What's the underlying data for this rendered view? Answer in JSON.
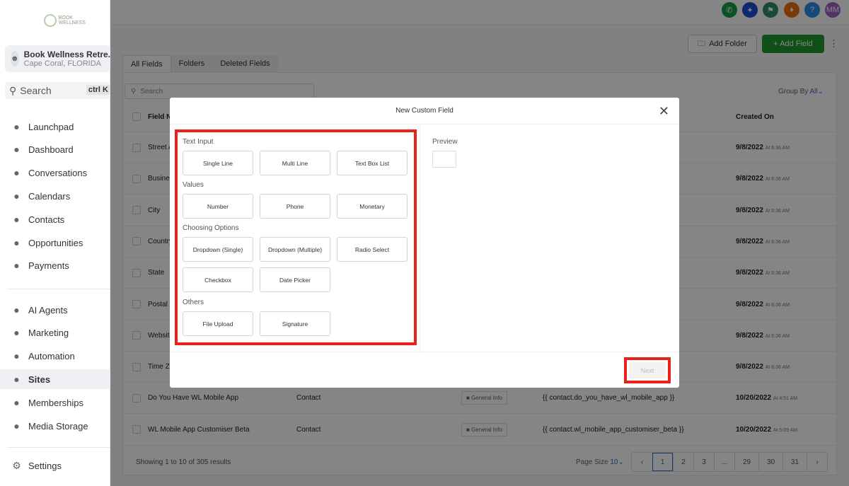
{
  "sidebar": {
    "logo_text": "BOOK WELLNESS",
    "location": {
      "name": "Book Wellness Retre...",
      "sub": "Cape Coral, FLORIDA"
    },
    "search": "Search",
    "search_shortcut": "ctrl K",
    "items": [
      {
        "label": "Launchpad",
        "icon": "rocket-icon"
      },
      {
        "label": "Dashboard",
        "icon": "grid-icon"
      },
      {
        "label": "Conversations",
        "icon": "chat-icon"
      },
      {
        "label": "Calendars",
        "icon": "calendar-icon"
      },
      {
        "label": "Contacts",
        "icon": "contacts-icon"
      },
      {
        "label": "Opportunities",
        "icon": "pipeline-icon"
      },
      {
        "label": "Payments",
        "icon": "payments-icon"
      }
    ],
    "items2": [
      {
        "label": "AI Agents",
        "icon": "sparkle-icon"
      },
      {
        "label": "Marketing",
        "icon": "send-icon"
      },
      {
        "label": "Automation",
        "icon": "automation-icon"
      },
      {
        "label": "Sites",
        "icon": "sites-icon",
        "active": true
      },
      {
        "label": "Memberships",
        "icon": "membership-icon"
      },
      {
        "label": "Media Storage",
        "icon": "image-icon"
      }
    ],
    "settings": "Settings"
  },
  "topbar": {
    "avatar": "MM",
    "help": "?",
    "colors": {
      "phone": "#1a9c4a",
      "spark": "#1e4fd6",
      "megaphone": "#2f8f63",
      "bell": "#f07010",
      "help": "#2b8be6",
      "avatar": "#a160c8"
    }
  },
  "toolbar": {
    "add_folder": "Add Folder",
    "add_field": "+ Add Field",
    "accent": "#1f9a2e"
  },
  "tabs": [
    "All Fields",
    "Folders",
    "Deleted Fields"
  ],
  "table": {
    "search_placeholder": "Search",
    "group_by_label": "Group By",
    "group_by_value": "All",
    "headers": {
      "name": "Field N",
      "created": "Created On"
    },
    "rows": [
      {
        "name": "Street A",
        "date": "9/8/2022",
        "time": "At 6:36 AM"
      },
      {
        "name": "Busines",
        "date": "9/8/2022",
        "time": "At 6:36 AM"
      },
      {
        "name": "City",
        "date": "9/8/2022",
        "time": "At 6:36 AM"
      },
      {
        "name": "Country",
        "date": "9/8/2022",
        "time": "At 6:36 AM"
      },
      {
        "name": "State",
        "date": "9/8/2022",
        "time": "At 6:36 AM"
      },
      {
        "name": "Postal C",
        "date": "9/8/2022",
        "time": "At 6:36 AM"
      },
      {
        "name": "Website",
        "date": "9/8/2022",
        "time": "At 6:36 AM"
      },
      {
        "name": "Time Z",
        "date": "9/8/2022",
        "time": "At 6:36 AM"
      },
      {
        "name": "Do You Have WL Mobile App",
        "object": "Contact",
        "folder": "General Info",
        "key": "{{ contact.do_you_have_wl_mobile_app }}",
        "date": "10/20/2022",
        "time": "At 4:51 AM"
      },
      {
        "name": "WL Mobile App Customiser Beta",
        "object": "Contact",
        "folder": "General Info",
        "key": "{{ contact.wl_mobile_app_customiser_beta }}",
        "date": "10/20/2022",
        "time": "At 5:09 AM"
      }
    ]
  },
  "pagination": {
    "summary": "Showing 1 to 10 of 305 results",
    "page_size_label": "Page Size",
    "page_size": "10",
    "pages": [
      "1",
      "2",
      "3",
      "...",
      "29",
      "30",
      "31"
    ],
    "current": "1"
  },
  "modal": {
    "title": "New Custom Field",
    "preview_label": "Preview",
    "next": "Next",
    "highlight_color": "#e8231b",
    "groups": [
      {
        "label": "Text Input",
        "options": [
          "Single Line",
          "Multi Line",
          "Text Box List"
        ]
      },
      {
        "label": "Values",
        "options": [
          "Number",
          "Phone",
          "Monetary"
        ]
      },
      {
        "label": "Choosing Options",
        "options": [
          "Dropdown (Single)",
          "Dropdown (Multiple)",
          "Radio Select",
          "Checkbox",
          "Date Picker"
        ]
      },
      {
        "label": "Others",
        "options": [
          "File Upload",
          "Signature"
        ]
      }
    ]
  }
}
